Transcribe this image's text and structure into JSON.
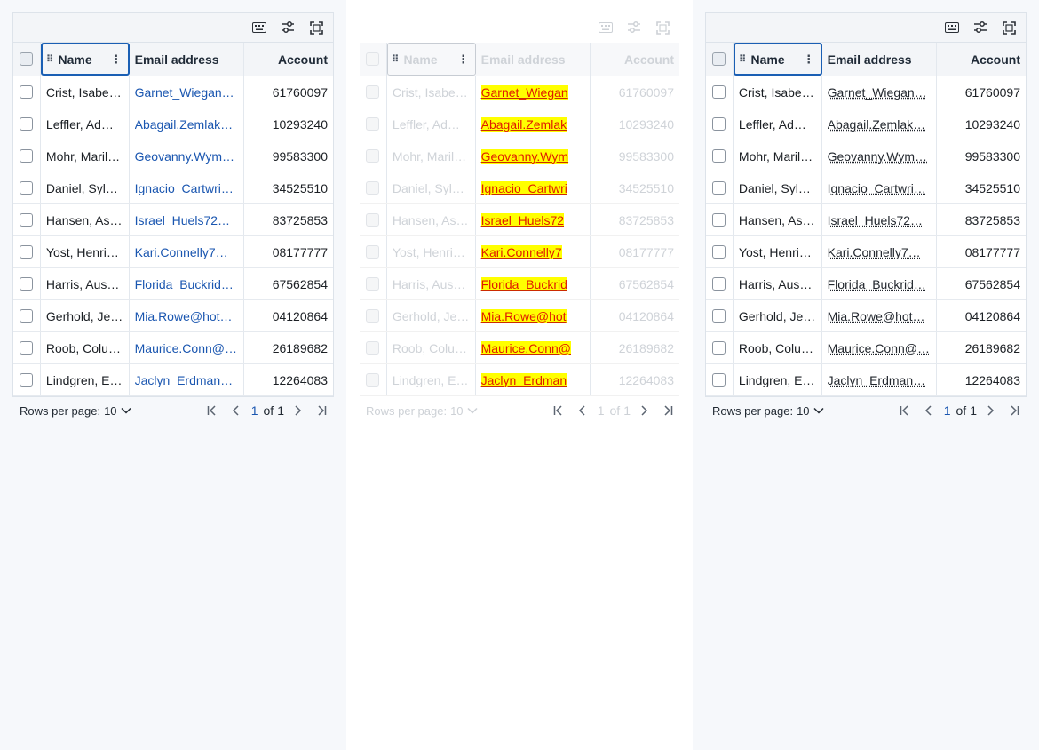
{
  "toolbar": {
    "icons": [
      "keyboard-icon",
      "filter-settings-icon",
      "fullscreen-icon"
    ]
  },
  "columns": {
    "name": "Name",
    "email": "Email address",
    "account": "Account"
  },
  "rows": [
    {
      "name": "Crist, Isabe…",
      "email": "Garnet_Wiegan…",
      "account": "61760097"
    },
    {
      "name": "Leffler, Ad…",
      "email": "Abagail.Zemlak…",
      "account": "10293240"
    },
    {
      "name": "Mohr, Maril…",
      "email": "Geovanny.Wym…",
      "account": "99583300"
    },
    {
      "name": "Daniel, Syl…",
      "email": "Ignacio_Cartwri…",
      "account": "34525510"
    },
    {
      "name": "Hansen, As…",
      "email": "Israel_Huels72…",
      "account": "83725853"
    },
    {
      "name": "Yost, Henri…",
      "email": "Kari.Connelly7…",
      "account": "08177777"
    },
    {
      "name": "Harris, Aus…",
      "email": "Florida_Buckrid…",
      "account": "67562854"
    },
    {
      "name": "Gerhold, Je…",
      "email": "Mia.Rowe@hot…",
      "account": "04120864"
    },
    {
      "name": "Roob, Colu…",
      "email": "Maurice.Conn@…",
      "account": "26189682"
    },
    {
      "name": "Lindgren, E…",
      "email": "Jaclyn_Erdman…",
      "account": "12264083"
    }
  ],
  "rows_middle": [
    {
      "name": "Crist, Isabe…",
      "email": "Garnet_Wiegan",
      "account": "61760097"
    },
    {
      "name": "Leffler, Ad…",
      "email": "Abagail.Zemlak",
      "account": "10293240"
    },
    {
      "name": "Mohr, Maril…",
      "email": "Geovanny.Wym",
      "account": "99583300"
    },
    {
      "name": "Daniel, Syl…",
      "email": "Ignacio_Cartwri",
      "account": "34525510"
    },
    {
      "name": "Hansen, As…",
      "email": "Israel_Huels72",
      "account": "83725853"
    },
    {
      "name": "Yost, Henri…",
      "email": "Kari.Connelly7",
      "account": "08177777"
    },
    {
      "name": "Harris, Aus…",
      "email": "Florida_Buckrid",
      "account": "67562854"
    },
    {
      "name": "Gerhold, Je…",
      "email": "Mia.Rowe@hot",
      "account": "04120864"
    },
    {
      "name": "Roob, Colu…",
      "email": "Maurice.Conn@",
      "account": "26189682"
    },
    {
      "name": "Lindgren, E…",
      "email": "Jaclyn_Erdman",
      "account": "12264083"
    }
  ],
  "footer": {
    "rows_per_page_label": "Rows per page:",
    "rows_per_page_value": "10",
    "page_current": "1",
    "page_of": "of",
    "page_total": "1"
  },
  "colors": {
    "accent": "#1a5fb4",
    "link": "#1a56b0",
    "highlight_bg": "#ffff00",
    "highlight_text": "#e01b00"
  }
}
